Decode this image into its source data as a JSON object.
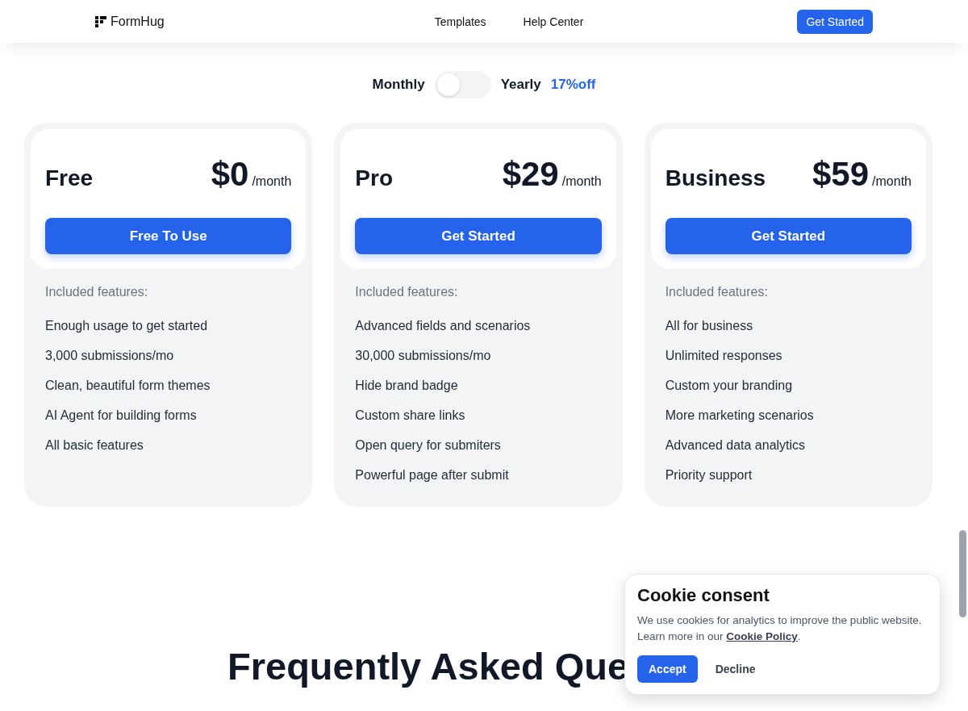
{
  "header": {
    "logo": "FormHug",
    "nav": [
      "Templates",
      "Help Center"
    ],
    "cta": "Get Started"
  },
  "billing_toggle": {
    "left_label": "Monthly",
    "right_label": "Yearly",
    "discount": "17%off",
    "on": false
  },
  "plans": [
    {
      "name": "Free",
      "price": "$0",
      "period": "/month",
      "button": "Free To Use",
      "features_title": "Included features:",
      "features": [
        "Enough usage to get started",
        "3,000 submissions/mo",
        "Clean, beautiful form themes",
        "AI Agent for building forms",
        "All basic features"
      ]
    },
    {
      "name": "Pro",
      "price": "$29",
      "period": "/month",
      "button": "Get Started",
      "features_title": "Included features:",
      "features": [
        "Advanced fields and scenarios",
        "30,000 submissions/mo",
        "Hide brand badge",
        "Custom share links",
        "Open query for submiters",
        "Powerful page after submit"
      ]
    },
    {
      "name": "Business",
      "price": "$59",
      "period": "/month",
      "button": "Get Started",
      "features_title": "Included features:",
      "features": [
        "All for business",
        "Unlimited responses",
        "Custom your branding",
        "More marketing scenarios",
        "Advanced data analytics",
        "Priority support"
      ]
    }
  ],
  "faq": {
    "title": "Frequently Asked Que"
  },
  "cookie_consent": {
    "title": "Cookie consent",
    "text": "We use cookies for analytics to improve the public website. Learn more in our",
    "link": "Cookie Policy",
    "after_link": ".",
    "accept": "Accept",
    "decline": "Decline"
  }
}
